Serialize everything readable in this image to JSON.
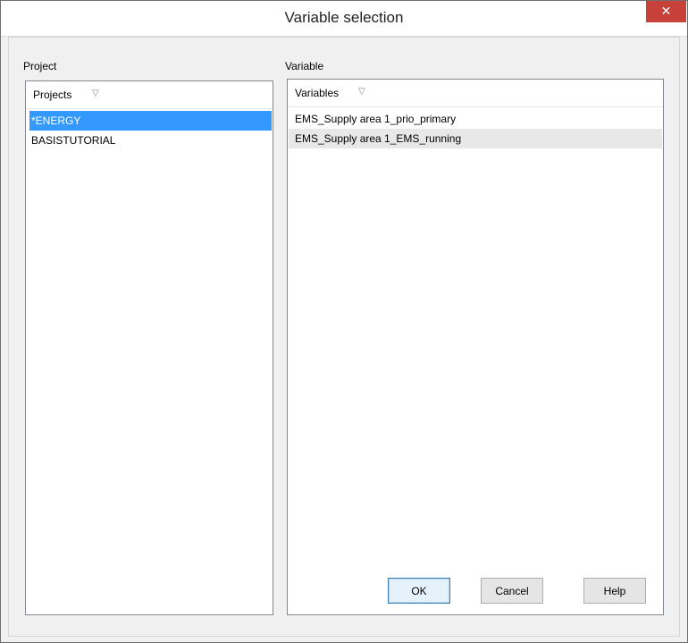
{
  "window": {
    "title": "Variable selection",
    "close_label": "✕"
  },
  "project_group": {
    "label": "Project",
    "header": "Projects",
    "items": [
      {
        "label": "*ENERGY",
        "selected": true
      },
      {
        "label": "BASISTUTORIAL",
        "selected": false
      }
    ]
  },
  "variable_group": {
    "label": "Variable",
    "header": "Variables",
    "items": [
      {
        "label": "EMS_Supply area 1_prio_primary",
        "highlighted": false
      },
      {
        "label": "EMS_Supply area 1_EMS_running",
        "highlighted": true
      }
    ]
  },
  "buttons": {
    "ok": "OK",
    "cancel": "Cancel",
    "help": "Help"
  },
  "icons": {
    "filter": "filter-icon",
    "close": "close-icon"
  },
  "colors": {
    "selection": "#3399ff",
    "close_button": "#c7403a"
  }
}
